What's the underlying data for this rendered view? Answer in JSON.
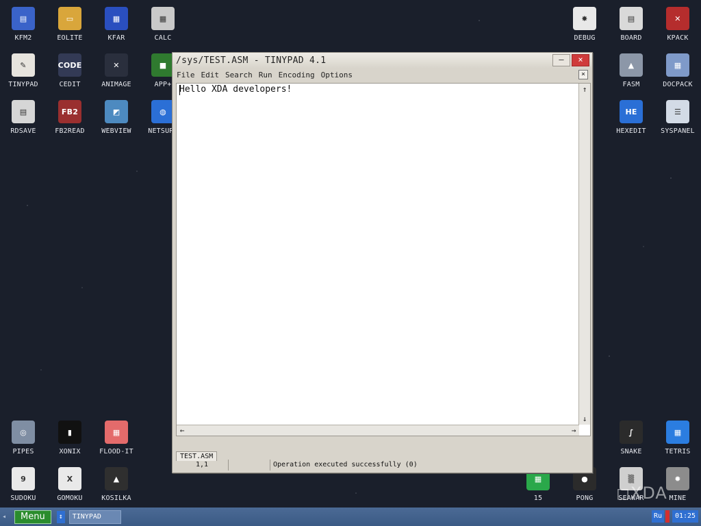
{
  "desktop": {
    "left_icons": [
      {
        "label": "KFM2",
        "icon": "floppy-icon",
        "color": "#3a63c9",
        "glyph": "▤"
      },
      {
        "label": "EOLITE",
        "icon": "folder-icon",
        "color": "#d9a63b",
        "glyph": "▭"
      },
      {
        "label": "KFAR",
        "icon": "archive-icon",
        "color": "#2a4fbf",
        "glyph": "▦"
      },
      {
        "label": "CALC",
        "icon": "calculator-icon",
        "color": "#c9c9c9",
        "glyph": "▦"
      },
      {
        "label": "TINYPAD",
        "icon": "notepad-icon",
        "color": "#e7e4de",
        "glyph": "✎"
      },
      {
        "label": "CEDIT",
        "icon": "code-editor-icon",
        "color": "#333a55",
        "glyph": "CODE"
      },
      {
        "label": "ANIMAGE",
        "icon": "pencil-brush-icon",
        "color": "#2a2f3d",
        "glyph": "✕"
      },
      {
        "label": "APP+",
        "icon": "cube-icon",
        "color": "#2f7a2f",
        "glyph": "■"
      },
      {
        "label": "RDSAVE",
        "icon": "disk-save-icon",
        "color": "#d6d6d6",
        "glyph": "▤"
      },
      {
        "label": "FB2READ",
        "icon": "book-icon",
        "color": "#9a2f2f",
        "glyph": "FB2"
      },
      {
        "label": "WEBVIEW",
        "icon": "map-globe-icon",
        "color": "#4d8ac0",
        "glyph": "◩"
      },
      {
        "label": "NETSURF",
        "icon": "globe-icon",
        "color": "#2b6fd6",
        "glyph": "◍"
      },
      {
        "label": "PIPES",
        "icon": "pipes-icon",
        "color": "#7f8ea3",
        "glyph": "◎"
      },
      {
        "label": "XONIX",
        "icon": "xonix-icon",
        "color": "#111",
        "glyph": "▮"
      },
      {
        "label": "FLOOD-IT",
        "icon": "color-grid-icon",
        "color": "#e46b6b",
        "glyph": "▦"
      },
      {
        "label": "SUDOKU",
        "icon": "sudoku-icon",
        "color": "#e9e9e9",
        "glyph": "9"
      },
      {
        "label": "GOMOKU",
        "icon": "tictactoe-icon",
        "color": "#e9e9e9",
        "glyph": "X"
      },
      {
        "label": "KOSILKA",
        "icon": "lawnmower-icon",
        "color": "#2f2f2f",
        "glyph": "▲"
      }
    ],
    "right_icons": [
      {
        "label": "DEBUG",
        "icon": "bug-icon",
        "color": "#e8e8e8",
        "glyph": "✸"
      },
      {
        "label": "BOARD",
        "icon": "clipboard-icon",
        "color": "#d9d9d9",
        "glyph": "▤"
      },
      {
        "label": "KPACK",
        "icon": "tools-icon",
        "color": "#b52d2d",
        "glyph": "✕"
      },
      {
        "label": "FASM",
        "icon": "anvil-icon",
        "color": "#8c97a8",
        "glyph": "▲"
      },
      {
        "label": "DOCPACK",
        "icon": "drawer-icon",
        "color": "#7f9ac9",
        "glyph": "▦"
      },
      {
        "label": "HEXEDIT",
        "icon": "hex-editor-icon",
        "color": "#2a6fd6",
        "glyph": "HE"
      },
      {
        "label": "SYSPANEL",
        "icon": "sliders-icon",
        "color": "#d3dbe6",
        "glyph": "☰"
      },
      {
        "label": "SNAKE",
        "icon": "snake-icon",
        "color": "#2b2b2b",
        "glyph": "∫"
      },
      {
        "label": "TETRIS",
        "icon": "tetris-icon",
        "color": "#2b7de0",
        "glyph": "▦"
      },
      {
        "label": "15",
        "icon": "puzzle-15-icon",
        "color": "#2aa84a",
        "glyph": "▦"
      },
      {
        "label": "PONG",
        "icon": "pong-icon",
        "color": "#2b2b2b",
        "glyph": "●"
      },
      {
        "label": "SEAWAR",
        "icon": "seawar-icon",
        "color": "#cfcfcf",
        "glyph": "▒"
      },
      {
        "label": "MINE",
        "icon": "mine-icon",
        "color": "#8c8c8c",
        "glyph": "✹"
      }
    ]
  },
  "window": {
    "title": "/sys/TEST.ASM - TINYPAD 4.1",
    "minimize_glyph": "–",
    "close_glyph": "×",
    "menu": [
      "File",
      "Edit",
      "Search",
      "Run",
      "Encoding",
      "Options"
    ],
    "menu_close_glyph": "×",
    "editor_text": "Hello XDA developers!",
    "scroll_up": "↑",
    "scroll_down": "↓",
    "scroll_left": "←",
    "scroll_right": "→",
    "tab_label": "TEST.ASM",
    "status_position": "1,1",
    "status_message": "Operation executed successfully (0)"
  },
  "taskbar": {
    "menu_label": "Menu",
    "swap_glyph": "↕",
    "task_label": "TINYPAD",
    "language": "Ru",
    "clock": "01:25"
  },
  "watermark": "◻XDA"
}
